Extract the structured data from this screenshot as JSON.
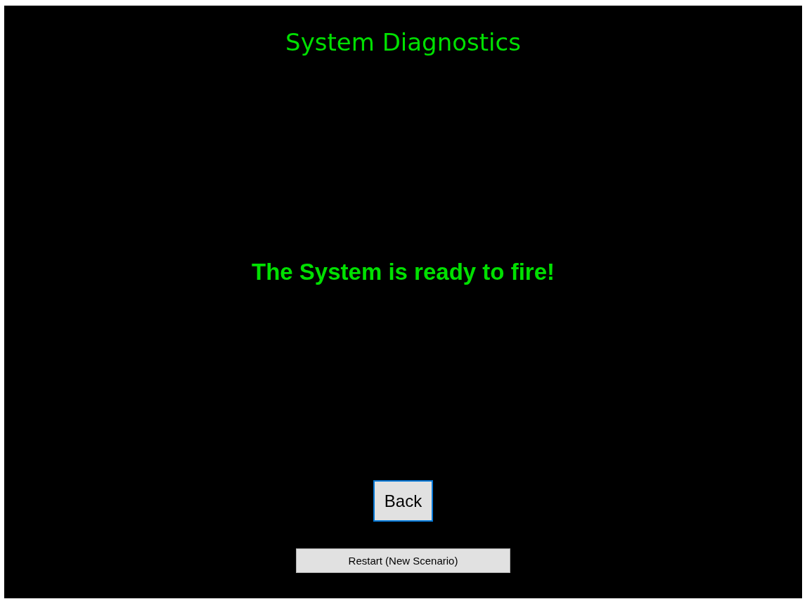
{
  "title": "System Diagnostics",
  "message": "The System is ready to fire!",
  "buttons": [
    {
      "label": "Back",
      "kind": "large",
      "focused": true
    },
    {
      "label": "Restart (New Scenario)",
      "kind": "wide",
      "focused": false
    }
  ]
}
